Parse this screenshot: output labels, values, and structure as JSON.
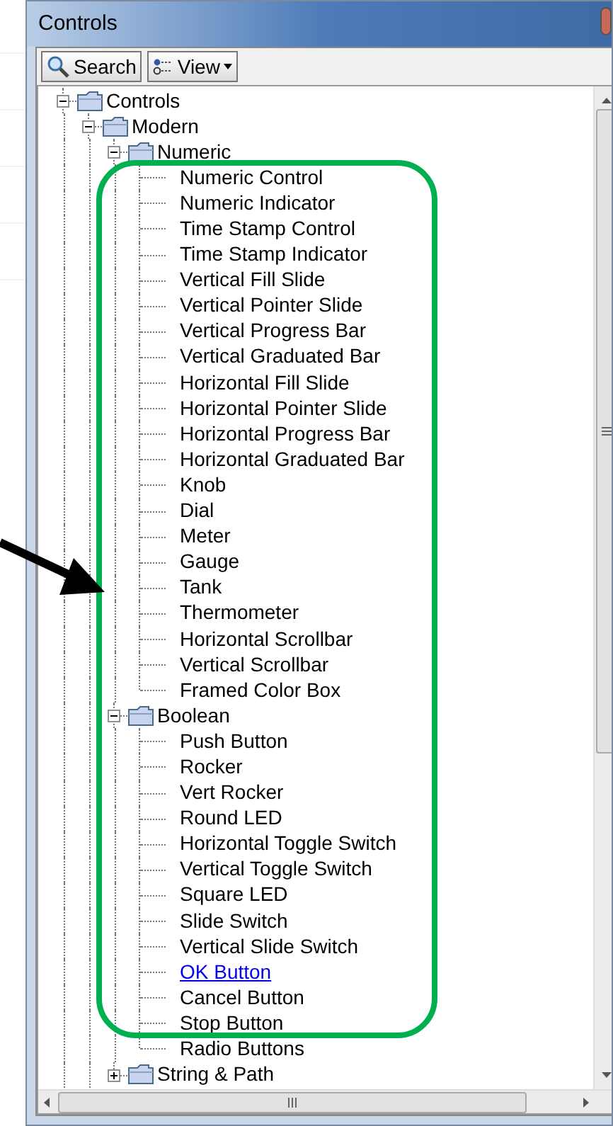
{
  "window": {
    "title": "Controls"
  },
  "toolbar": [
    {
      "kind": "search",
      "label": "Search"
    },
    {
      "kind": "view",
      "label": "View"
    }
  ],
  "tree": [
    {
      "label": "Controls",
      "expanded": true,
      "children": [
        {
          "label": "Modern",
          "expanded": true,
          "children": [
            {
              "label": "Numeric",
              "expanded": true,
              "children": [
                {
                  "label": "Numeric Control",
                  "hovered": false
                },
                {
                  "label": "Numeric Indicator",
                  "hovered": false
                },
                {
                  "label": "Time Stamp Control",
                  "hovered": false
                },
                {
                  "label": "Time Stamp Indicator",
                  "hovered": false
                },
                {
                  "label": "Vertical Fill Slide",
                  "hovered": false
                },
                {
                  "label": "Vertical Pointer Slide",
                  "hovered": false
                },
                {
                  "label": "Vertical Progress Bar",
                  "hovered": false
                },
                {
                  "label": "Vertical Graduated Bar",
                  "hovered": false
                },
                {
                  "label": "Horizontal Fill Slide",
                  "hovered": false
                },
                {
                  "label": "Horizontal Pointer Slide",
                  "hovered": false
                },
                {
                  "label": "Horizontal Progress Bar",
                  "hovered": false
                },
                {
                  "label": "Horizontal Graduated Bar",
                  "hovered": false
                },
                {
                  "label": "Knob",
                  "hovered": false
                },
                {
                  "label": "Dial",
                  "hovered": false
                },
                {
                  "label": "Meter",
                  "hovered": false
                },
                {
                  "label": "Gauge",
                  "hovered": false
                },
                {
                  "label": "Tank",
                  "hovered": false
                },
                {
                  "label": "Thermometer",
                  "hovered": false
                },
                {
                  "label": "Horizontal Scrollbar",
                  "hovered": false
                },
                {
                  "label": "Vertical Scrollbar",
                  "hovered": false
                },
                {
                  "label": "Framed Color Box",
                  "hovered": false
                }
              ]
            },
            {
              "label": "Boolean",
              "expanded": true,
              "children": [
                {
                  "label": "Push Button",
                  "hovered": false
                },
                {
                  "label": "Rocker",
                  "hovered": false
                },
                {
                  "label": "Vert Rocker",
                  "hovered": false
                },
                {
                  "label": "Round LED",
                  "hovered": false
                },
                {
                  "label": "Horizontal Toggle Switch",
                  "hovered": false
                },
                {
                  "label": "Vertical Toggle Switch",
                  "hovered": false
                },
                {
                  "label": "Square LED",
                  "hovered": false
                },
                {
                  "label": "Slide Switch",
                  "hovered": false
                },
                {
                  "label": "Vertical Slide Switch",
                  "hovered": false
                },
                {
                  "label": "OK Button",
                  "hovered": true
                },
                {
                  "label": "Cancel Button",
                  "hovered": false
                },
                {
                  "label": "Stop Button",
                  "hovered": false
                },
                {
                  "label": "Radio Buttons",
                  "hovered": false
                }
              ]
            },
            {
              "label": "String & Path",
              "expanded": false
            }
          ]
        }
      ]
    }
  ]
}
